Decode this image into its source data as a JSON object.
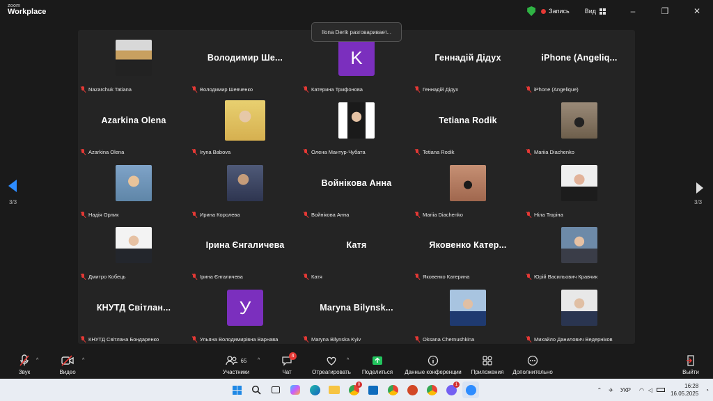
{
  "titlebar": {
    "logo_top": "zoom",
    "logo_bottom": "Workplace",
    "record_label": "Запись",
    "view_label": "Вид",
    "view_icon": "grid-icon",
    "minimize": "–",
    "restore": "❐",
    "close": "✕"
  },
  "speaking": "Ilona Derik разговаривает...",
  "pager": {
    "left": "3/3",
    "right": "3/3"
  },
  "tiles": [
    {
      "big": "",
      "avatar": "",
      "name": "Nazarchuk Tatiana"
    },
    {
      "big": "Володимир  Ше...",
      "avatar": "",
      "name": "Володимир Шевченко"
    },
    {
      "big": "",
      "avatar": "K",
      "name": "Катерина Трифонова"
    },
    {
      "big": "Геннадій Дідух",
      "avatar": "",
      "name": "Геннадій Дідух"
    },
    {
      "big": "iPhone  (Angeliq...",
      "avatar": "",
      "name": "iPhone (Angelique)"
    },
    {
      "big": "Azarkina Olena",
      "avatar": "",
      "name": "Azarkina Olena"
    },
    {
      "big": "",
      "avatar": "",
      "name": "Iryna Babova"
    },
    {
      "big": "",
      "avatar": "",
      "name": "Олена Мантур-Чубата"
    },
    {
      "big": "Tetiana Rodik",
      "avatar": "",
      "name": "Tetiana Rodik"
    },
    {
      "big": "",
      "avatar": "",
      "name": "Mariia Diachenko"
    },
    {
      "big": "",
      "avatar": "",
      "name": "Надія Орлик"
    },
    {
      "big": "",
      "avatar": "",
      "name": "Ирина Королева"
    },
    {
      "big": "Войнікова Анна",
      "avatar": "",
      "name": "Войнікова Анна"
    },
    {
      "big": "",
      "avatar": "",
      "name": "Mariia Diachenko"
    },
    {
      "big": "",
      "avatar": "",
      "name": "Ніла Тюріна"
    },
    {
      "big": "",
      "avatar": "",
      "name": "Дмитро Кобець"
    },
    {
      "big": "Ірина Єнгаличева",
      "avatar": "",
      "name": "Ірина Єнгаличева"
    },
    {
      "big": "Катя",
      "avatar": "",
      "name": "Катя"
    },
    {
      "big": "Яковенко  Катер...",
      "avatar": "",
      "name": "Яковенко Катерина"
    },
    {
      "big": "",
      "avatar": "",
      "name": "Юрій Васильович Кравчик"
    },
    {
      "big": "КНУТД  Світлан...",
      "avatar": "",
      "name": "КНУТД Світлана Бондаренко"
    },
    {
      "big": "",
      "avatar": "У",
      "name": "Ульяна Володимирівна Варнава"
    },
    {
      "big": "Maryna  Bilynsk...",
      "avatar": "",
      "name": "Maryna Bilynska Kyiv"
    },
    {
      "big": "",
      "avatar": "",
      "name": "Oksana Chernushkina"
    },
    {
      "big": "",
      "avatar": "",
      "name": "Михайло Данилович Ведерніков"
    }
  ],
  "toolbar": {
    "audio": "Звук",
    "video": "Видео",
    "participants": "Участники",
    "participants_count": "65",
    "chat": "Чат",
    "chat_badge": "4",
    "react": "Отреагировать",
    "share": "Поделиться",
    "info": "Данные конференции",
    "apps": "Приложения",
    "more": "Дополнительно",
    "leave": "Выйти"
  },
  "taskbar": {
    "lang": "УКР",
    "time": "16:28",
    "date": "16.05.2025",
    "badge_a": "0",
    "badge_b": "1"
  },
  "colors": {
    "accent": "#2d8cff",
    "avatar_purple": "#7b2fbe",
    "muted_red": "#e53935",
    "share_green": "#22c55e"
  }
}
